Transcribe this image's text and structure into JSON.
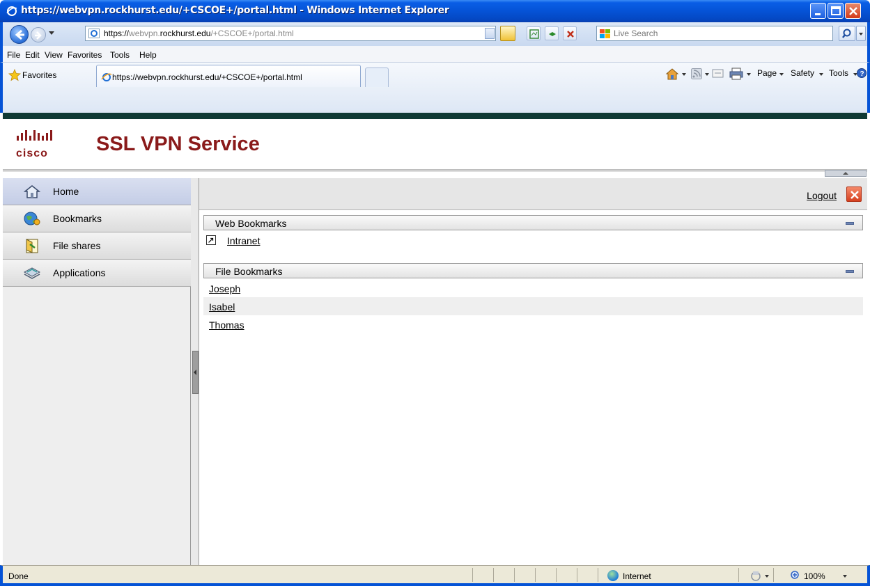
{
  "window": {
    "title": "https://webvpn.rockhurst.edu/+CSCOE+/portal.html - Windows Internet Explorer"
  },
  "address": {
    "url_prefix": "https://",
    "url_host_pre": "webvpn.",
    "url_host": "rockhurst.edu",
    "url_path": "/+CSCOE+/portal.html"
  },
  "search": {
    "placeholder": "Live Search"
  },
  "menu": {
    "file": "File",
    "edit": "Edit",
    "view": "View",
    "favorites": "Favorites",
    "tools": "Tools",
    "help": "Help"
  },
  "favbar": {
    "favorites_label": "Favorites",
    "tab_title": "https://webvpn.rockhurst.edu/+CSCOE+/portal.html"
  },
  "commandbar": {
    "page": "Page",
    "safety": "Safety",
    "tools": "Tools"
  },
  "portal": {
    "brand_title": "SSL VPN Service",
    "logout": "Logout",
    "sidebar": [
      {
        "label": "Home",
        "icon": "home-icon"
      },
      {
        "label": "Bookmarks",
        "icon": "bookmarks-globe-icon"
      },
      {
        "label": "File shares",
        "icon": "file-shares-icon"
      },
      {
        "label": "Applications",
        "icon": "applications-icon"
      }
    ],
    "web_bookmarks": {
      "header": "Web Bookmarks",
      "items": [
        "Intranet"
      ]
    },
    "file_bookmarks": {
      "header": "File Bookmarks",
      "items": [
        "Joseph",
        "Isabel",
        "Thomas"
      ]
    }
  },
  "status": {
    "text": "Done",
    "zone": "Internet",
    "zoom": "100%"
  },
  "colors": {
    "brand_title": "#8a1a1a",
    "header_band": "#103a35",
    "xp_frame": "#0553d6"
  }
}
